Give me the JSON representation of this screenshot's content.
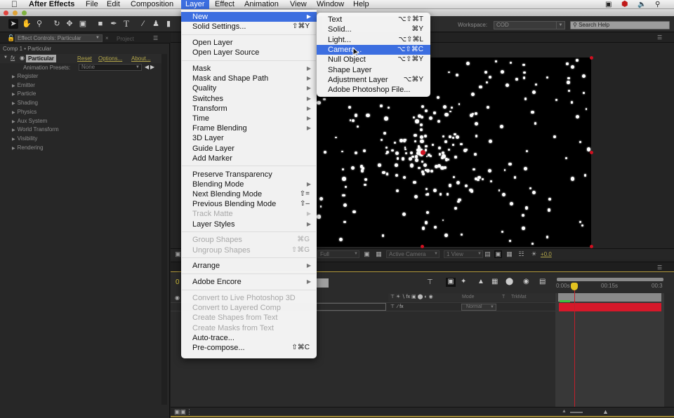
{
  "menubar": {
    "apple_icon": "apple-icon",
    "app_name": "After Effects",
    "items": [
      "File",
      "Edit",
      "Composition",
      "Layer",
      "Effect",
      "Animation",
      "View",
      "Window",
      "Help"
    ],
    "active_item": "Layer",
    "tray_icons": [
      "screen-record-icon",
      "shield-icon",
      "volume-icon",
      "spotlight-search-icon"
    ]
  },
  "toolbar": {
    "tools": [
      "selection-tool",
      "hand-tool",
      "zoom-tool",
      "rotation-tool",
      "camera-orbit-tool",
      "pan-behind-tool",
      "rectangle-tool",
      "pen-tool",
      "type-tool",
      "brush-tool",
      "clone-stamp-tool",
      "eraser-tool"
    ],
    "workspace_label": "Workspace:",
    "workspace_value": "COD",
    "search_placeholder": "Search Help"
  },
  "effect_controls": {
    "tab_label": "Effect Controls: Particular",
    "project_tab": "Project",
    "breadcrumb": "Comp 1 • Particular",
    "effect_name": "Particular",
    "links": [
      "Reset",
      "Options...",
      "About..."
    ],
    "presets_label": "Animation Presets:",
    "presets_value": "None",
    "properties": [
      "Register",
      "Emitter",
      "Particle",
      "Shading",
      "Physics",
      "Aux System",
      "World Transform",
      "Visibility",
      "Rendering"
    ]
  },
  "viewer": {
    "resolution": "Full",
    "camera": "Active Camera",
    "views": "1 View",
    "exposure": "+0.0"
  },
  "timeline": {
    "columns": {
      "mode": "Mode",
      "t": "T",
      "trkmat": "TrkMat"
    },
    "layer_mode": "Normal",
    "time_ticks": [
      "0:00s",
      "00:15s",
      "00:3"
    ],
    "layer_bar_color": "#d6182a",
    "cti_color": "#e3c320"
  },
  "layer_menu": {
    "items": [
      {
        "label": "New",
        "submenu": true,
        "highlighted": true
      },
      {
        "label": "Solid Settings...",
        "shortcut": "⇧⌘Y"
      },
      {
        "sep": true
      },
      {
        "label": "Open Layer"
      },
      {
        "label": "Open Layer Source"
      },
      {
        "sep": true
      },
      {
        "label": "Mask",
        "submenu": true
      },
      {
        "label": "Mask and Shape Path",
        "submenu": true
      },
      {
        "label": "Quality",
        "submenu": true
      },
      {
        "label": "Switches",
        "submenu": true
      },
      {
        "label": "Transform",
        "submenu": true
      },
      {
        "label": "Time",
        "submenu": true
      },
      {
        "label": "Frame Blending",
        "submenu": true
      },
      {
        "label": "3D Layer"
      },
      {
        "label": "Guide Layer"
      },
      {
        "label": "Add Marker"
      },
      {
        "sep": true
      },
      {
        "label": "Preserve Transparency"
      },
      {
        "label": "Blending Mode",
        "submenu": true
      },
      {
        "label": "Next Blending Mode",
        "shortcut": "⇧="
      },
      {
        "label": "Previous Blending Mode",
        "shortcut": "⇧–"
      },
      {
        "label": "Track Matte",
        "submenu": true,
        "disabled": true
      },
      {
        "label": "Layer Styles",
        "submenu": true
      },
      {
        "sep": true
      },
      {
        "label": "Group Shapes",
        "shortcut": "⌘G",
        "disabled": true
      },
      {
        "label": "Ungroup Shapes",
        "shortcut": "⇧⌘G",
        "disabled": true
      },
      {
        "sep": true
      },
      {
        "label": "Arrange",
        "submenu": true
      },
      {
        "sep": true
      },
      {
        "label": "Adobe Encore",
        "submenu": true
      },
      {
        "sep": true
      },
      {
        "label": "Convert to Live Photoshop 3D",
        "disabled": true
      },
      {
        "label": "Convert to Layered Comp",
        "disabled": true
      },
      {
        "label": "Create Shapes from Text",
        "disabled": true
      },
      {
        "label": "Create Masks from Text",
        "disabled": true
      },
      {
        "label": "Auto-trace..."
      },
      {
        "label": "Pre-compose...",
        "shortcut": "⇧⌘C"
      }
    ]
  },
  "new_submenu": {
    "items": [
      {
        "label": "Text",
        "shortcut": "⌥⇧⌘T"
      },
      {
        "label": "Solid...",
        "shortcut": "⌘Y"
      },
      {
        "label": "Light...",
        "shortcut": "⌥⇧⌘L"
      },
      {
        "label": "Camera...",
        "shortcut": "⌥⇧⌘C",
        "highlighted": true
      },
      {
        "label": "Null Object",
        "shortcut": "⌥⇧⌘Y"
      },
      {
        "label": "Shape Layer"
      },
      {
        "label": "Adjustment Layer",
        "shortcut": "⌥⌘Y"
      },
      {
        "label": "Adobe Photoshop File..."
      }
    ]
  }
}
